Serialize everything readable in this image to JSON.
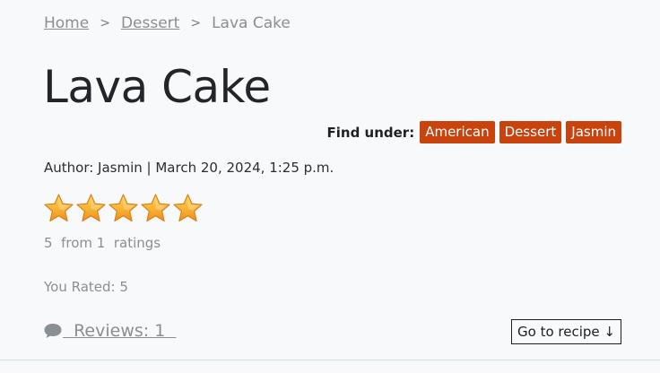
{
  "breadcrumb": {
    "home": "Home",
    "separator": ">",
    "category": "Dessert",
    "current": "Lava Cake"
  },
  "recipe": {
    "title": "Lava Cake",
    "find_under_label": "Find under:",
    "tags": [
      "American",
      "Dessert",
      "Jasmin"
    ],
    "author_line": "Author: Jasmin | March 20, 2024, 1:25 p.m."
  },
  "rating": {
    "stars_filled": 5,
    "stars_total": 5,
    "summary": "5  from 1  ratings",
    "you_rated": "You Rated: 5"
  },
  "reviews": {
    "label": "  Reviews: 1  "
  },
  "actions": {
    "go_to_recipe": "Go to recipe ↓"
  },
  "icons": {
    "star": "star-icon",
    "comment": "comment-icon"
  },
  "colors": {
    "tag_bg": "#c8430e",
    "star_fill": "#f5a623",
    "muted_text": "#8a8f94"
  }
}
